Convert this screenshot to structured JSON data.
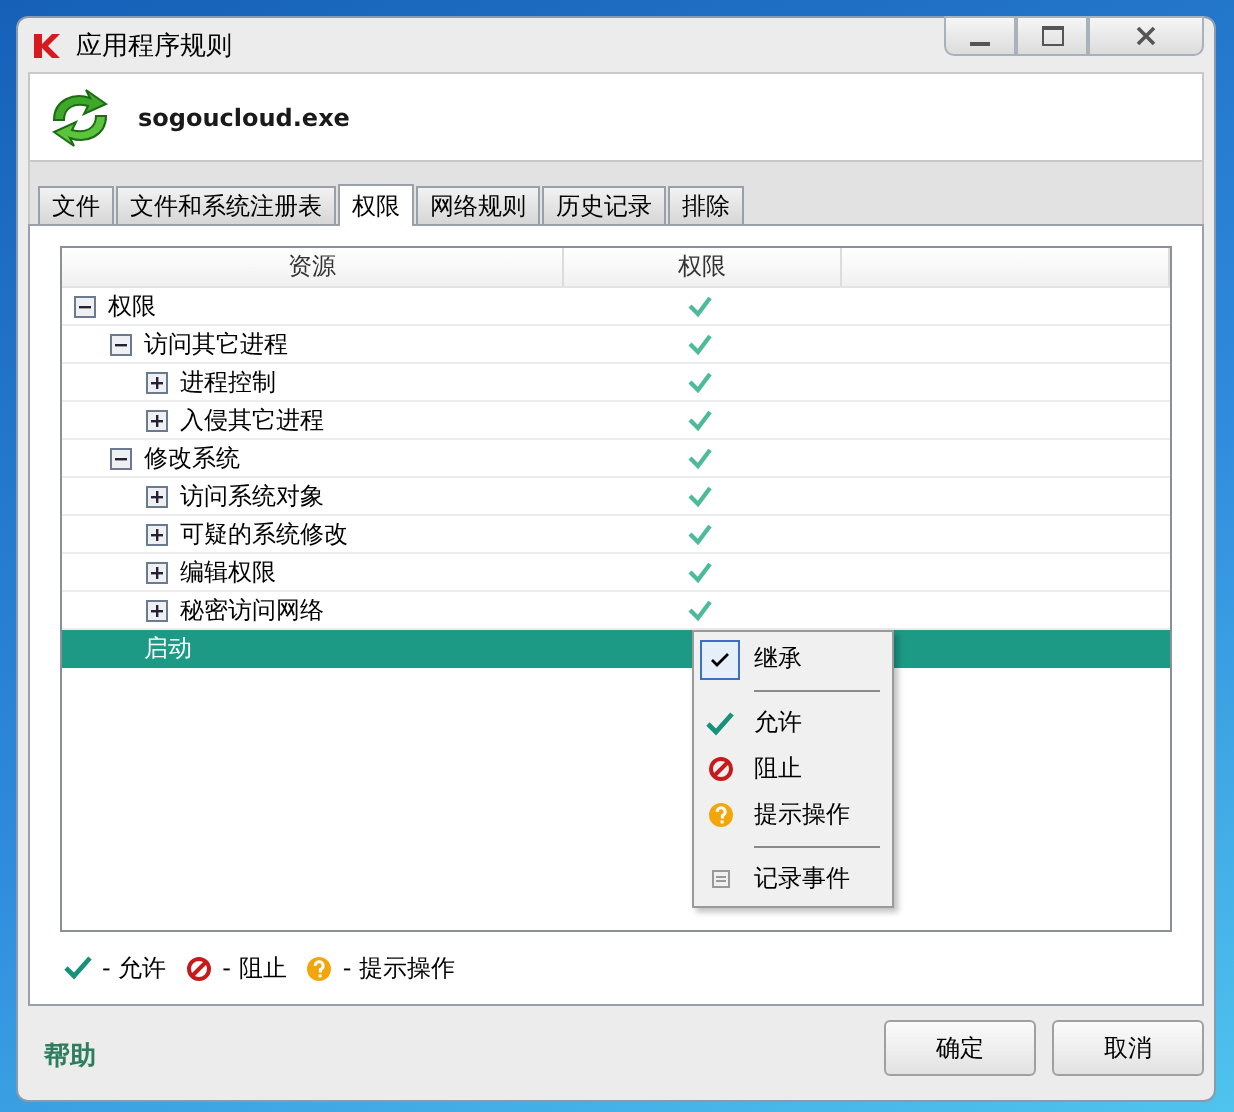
{
  "window": {
    "title": "应用程序规则"
  },
  "app": {
    "name": "sogoucloud.exe"
  },
  "tabs": [
    {
      "label": "文件",
      "selected": false
    },
    {
      "label": "文件和系统注册表",
      "selected": false
    },
    {
      "label": "权限",
      "selected": true
    },
    {
      "label": "网络规则",
      "selected": false
    },
    {
      "label": "历史记录",
      "selected": false
    },
    {
      "label": "排除",
      "selected": false
    }
  ],
  "table": {
    "columns": [
      "资源",
      "权限"
    ],
    "rows": [
      {
        "label": "权限",
        "expanded": true,
        "selected": false,
        "kind": "allow",
        "children": [
          {
            "label": "访问其它进程",
            "expanded": true,
            "selected": false,
            "kind": "allow",
            "children": [
              {
                "label": "进程控制",
                "expanded": false,
                "selected": false,
                "kind": "allow"
              },
              {
                "label": "入侵其它进程",
                "expanded": false,
                "selected": false,
                "kind": "allow"
              }
            ]
          },
          {
            "label": "修改系统",
            "expanded": true,
            "selected": false,
            "kind": "allow",
            "children": [
              {
                "label": "访问系统对象",
                "expanded": false,
                "selected": false,
                "kind": "allow"
              },
              {
                "label": "可疑的系统修改",
                "expanded": false,
                "selected": false,
                "kind": "allow"
              },
              {
                "label": "编辑权限",
                "expanded": false,
                "selected": false,
                "kind": "allow"
              },
              {
                "label": "秘密访问网络",
                "expanded": false,
                "selected": false,
                "kind": "allow"
              }
            ]
          },
          {
            "label": "启动",
            "selected": true
          }
        ]
      }
    ]
  },
  "context_menu": [
    {
      "kind": "inherit",
      "label": "继承",
      "checked": true
    },
    {
      "kind": "separator"
    },
    {
      "kind": "allow",
      "label": "允许"
    },
    {
      "kind": "block",
      "label": "阻止"
    },
    {
      "kind": "ask",
      "label": "提示操作"
    },
    {
      "kind": "separator"
    },
    {
      "kind": "log",
      "label": "记录事件"
    }
  ],
  "legend": [
    {
      "kind": "allow",
      "label": "- 允许"
    },
    {
      "kind": "block",
      "label": "- 阻止"
    },
    {
      "kind": "ask",
      "label": "- 提示操作"
    }
  ],
  "help_link": "帮助",
  "buttons": [
    "确定",
    "取消"
  ]
}
